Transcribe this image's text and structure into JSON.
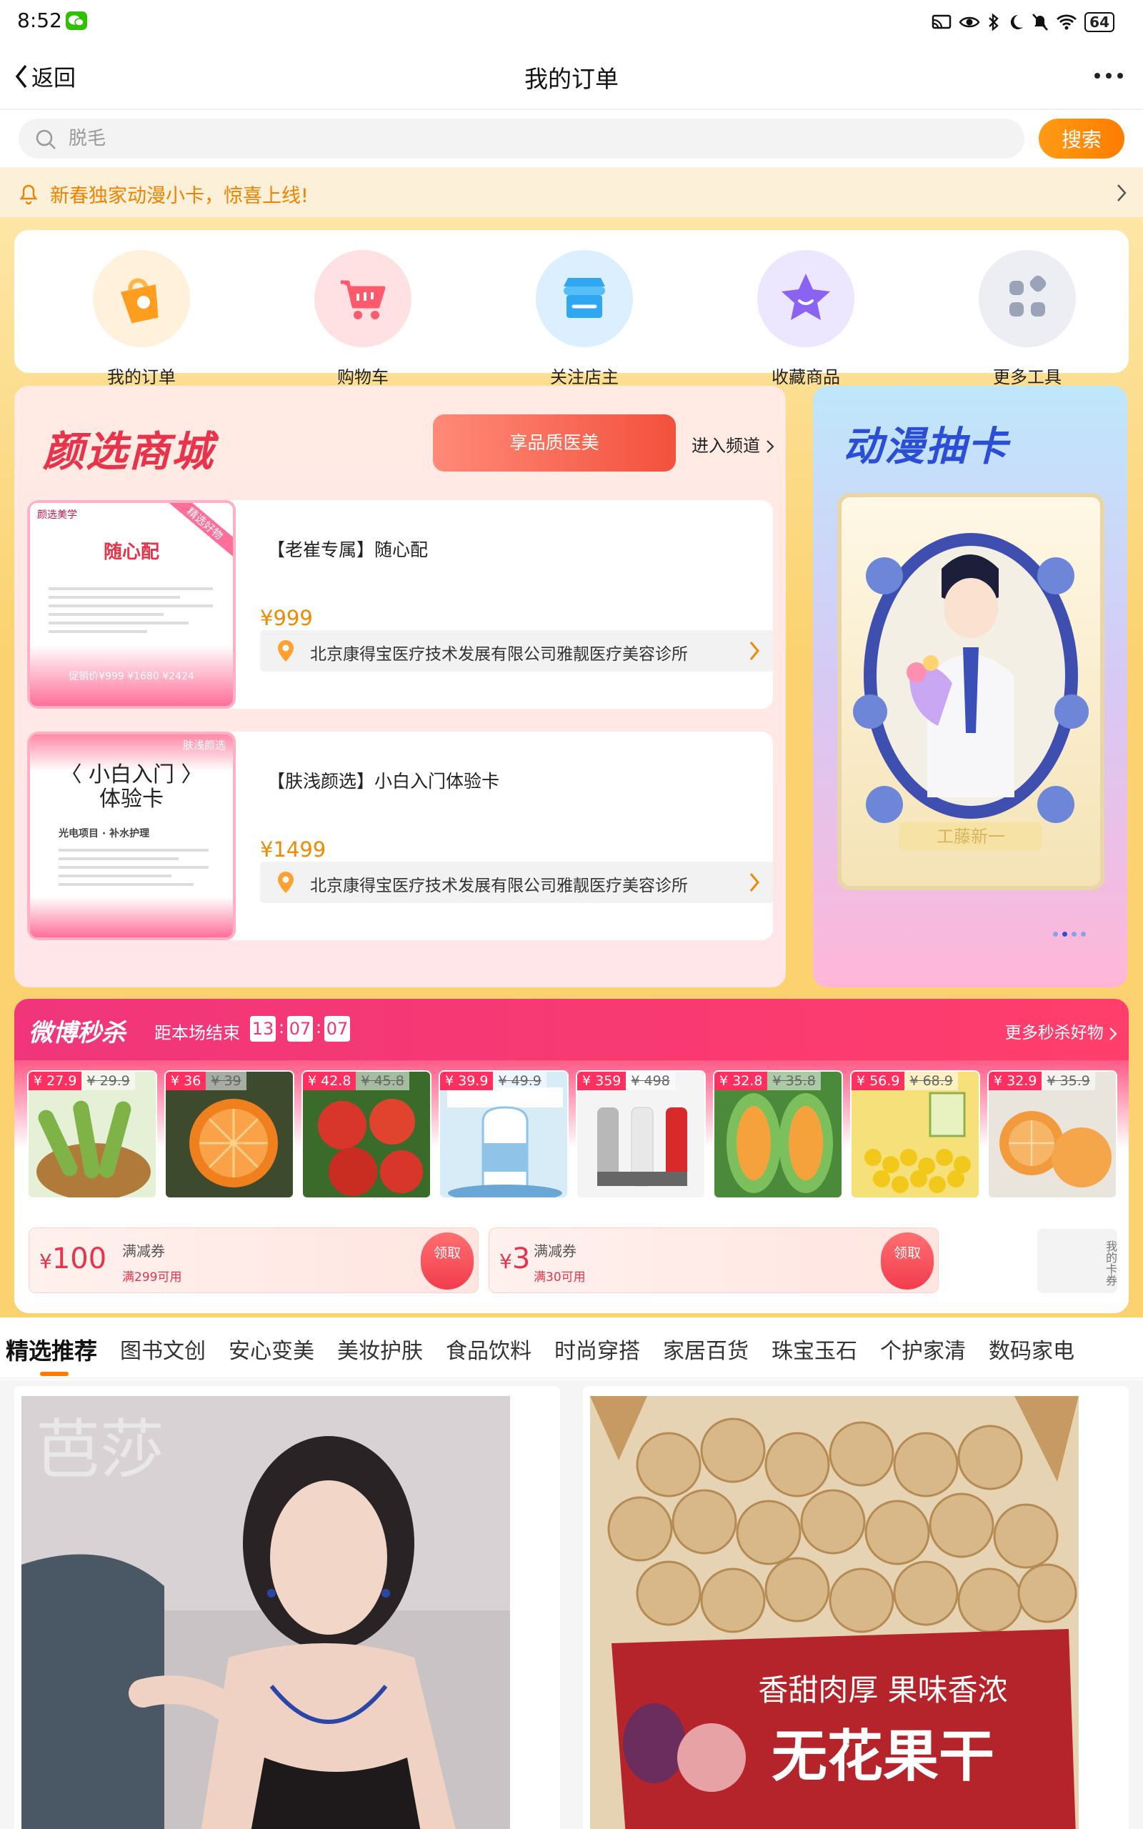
{
  "status": {
    "time": "8:52",
    "battery": "64"
  },
  "nav": {
    "back_label": "返回",
    "title": "我的订单"
  },
  "search": {
    "placeholder": "脱毛",
    "button_label": "搜索"
  },
  "notice": {
    "text": "新春独家动漫小卡，惊喜上线!"
  },
  "quick_tools": [
    {
      "label": "我的订单",
      "icon": "order-bag-icon",
      "color": "#ffa726"
    },
    {
      "label": "购物车",
      "icon": "cart-icon",
      "color": "#ff5a6b"
    },
    {
      "label": "关注店主",
      "icon": "store-icon",
      "color": "#2fa7f2"
    },
    {
      "label": "收藏商品",
      "icon": "star-icon",
      "color": "#8a63f2"
    },
    {
      "label": "更多工具",
      "icon": "grid-icon",
      "color": "#9aa3b8"
    }
  ],
  "mall": {
    "title": "颜选商城",
    "pill_label": "享品质医美",
    "enter_label": "进入频道",
    "products": [
      {
        "title": "【老崔专属】随心配",
        "price": "¥999",
        "store": "北京康得宝医疗技术发展有限公司雅靓医疗美容诊所",
        "thumb": {
          "brand": "颜选美学",
          "corner": "精选好物",
          "headline": "随心配",
          "line": "促销价¥999  ¥1680  ¥2424"
        }
      },
      {
        "title": "【肤浅颜选】小白入门体验卡",
        "price": "¥1499",
        "store": "北京康得宝医疗技术发展有限公司雅靓医疗美容诊所",
        "thumb": {
          "brand": "",
          "corner": "肤浅颜选",
          "headline": "〈 小白入门 〉\n体验卡",
          "line": "光电项目 · 补水护理"
        }
      }
    ]
  },
  "anime": {
    "title": "动漫抽卡",
    "card_name": "工藤新一"
  },
  "flash_sale": {
    "title": "微博秒杀",
    "ends_label": "距本场结束",
    "countdown": [
      "13",
      "07",
      "07"
    ],
    "more_label": "更多秒杀好物",
    "items": [
      {
        "price": "¥ 27.9",
        "orig": "¥ 29.9",
        "color": "#7fb347",
        "icon": "cucumber-icon"
      },
      {
        "price": "¥ 36",
        "orig": "¥ 39",
        "color": "#f07f1e",
        "icon": "orange-icon"
      },
      {
        "price": "¥ 42.8",
        "orig": "¥ 45.8",
        "color": "#d9362b",
        "icon": "tomato-icon"
      },
      {
        "price": "¥ 39.9",
        "orig": "¥ 49.9",
        "color": "#8fc3e8",
        "icon": "yogurt-icon"
      },
      {
        "price": "¥ 359",
        "orig": "¥ 498",
        "color": "#cfcfcf",
        "icon": "grinder-icon"
      },
      {
        "price": "¥ 32.8",
        "orig": "¥ 35.8",
        "color": "#5fa34a",
        "icon": "melon-icon"
      },
      {
        "price": "¥ 56.9",
        "orig": "¥ 68.9",
        "color": "#f2c81a",
        "icon": "corn-icon"
      },
      {
        "price": "¥ 32.9",
        "orig": "¥ 35.9",
        "color": "#f39a3c",
        "icon": "tangerine-icon"
      }
    ]
  },
  "coupons": [
    {
      "amount": "100",
      "type": "满减券",
      "condition": "满299可用",
      "button": "领取"
    },
    {
      "amount": "3",
      "type": "满减券",
      "condition": "满30可用",
      "button": "领取"
    }
  ],
  "my_coupons_label": "我的卡券",
  "categories": [
    "精选推荐",
    "图书文创",
    "安心变美",
    "美妆护肤",
    "食品饮料",
    "时尚穿搭",
    "家居百货",
    "珠宝玉石",
    "个护家清",
    "数码家电"
  ],
  "feed": [
    {
      "image": "model-jewelry-photo",
      "overlay": "芭莎"
    },
    {
      "image": "dried-figs-photo",
      "line1": "香甜肉厚 果味香浓",
      "line2": "无花果干"
    }
  ]
}
